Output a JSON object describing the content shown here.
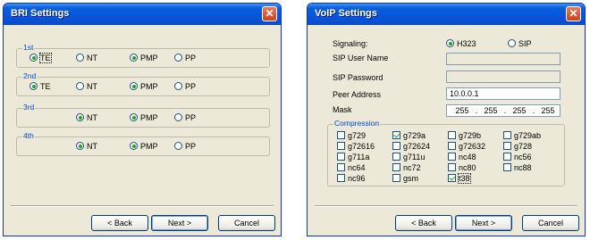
{
  "bri": {
    "title": "BRI Settings",
    "close": "✕",
    "ports": [
      {
        "label": "1st",
        "te": "TE",
        "nt": "NT",
        "pmp": "PMP",
        "pp": "PP"
      },
      {
        "label": "2nd",
        "te": "TE",
        "nt": "NT",
        "pmp": "PMP",
        "pp": "PP"
      },
      {
        "label": "3rd",
        "nt": "NT",
        "pmp": "PMP",
        "pp": "PP"
      },
      {
        "label": "4th",
        "nt": "NT",
        "pmp": "PMP",
        "pp": "PP"
      }
    ],
    "buttons": {
      "back": "< Back",
      "next": "Next >",
      "cancel": "Cancel"
    }
  },
  "voip": {
    "title": "VoIP Settings",
    "close": "✕",
    "signaling_label": "Signaling:",
    "signaling_options": [
      "H323",
      "SIP"
    ],
    "sip_user_label": "SIP User Name",
    "sip_password_label": "SIP Password",
    "peer_address_label": "Peer Address",
    "peer_address_value": "10.0.0.1",
    "mask_label": "Mask",
    "mask_octets": [
      "255",
      "255",
      "255",
      "255"
    ],
    "mask_dot": ".",
    "compression_label": "Compression",
    "codecs": [
      {
        "name": "g729",
        "checked": false
      },
      {
        "name": "g729a",
        "checked": true
      },
      {
        "name": "g729b",
        "checked": false
      },
      {
        "name": "g729ab",
        "checked": false
      },
      {
        "name": "g72616",
        "checked": false
      },
      {
        "name": "g72624",
        "checked": false
      },
      {
        "name": "g72632",
        "checked": false
      },
      {
        "name": "g728",
        "checked": false
      },
      {
        "name": "g711a",
        "checked": false
      },
      {
        "name": "g711u",
        "checked": false
      },
      {
        "name": "nc48",
        "checked": false
      },
      {
        "name": "nc56",
        "checked": false
      },
      {
        "name": "nc64",
        "checked": false
      },
      {
        "name": "nc72",
        "checked": false
      },
      {
        "name": "nc80",
        "checked": false
      },
      {
        "name": "nc88",
        "checked": false
      },
      {
        "name": "nc96",
        "checked": false
      },
      {
        "name": "gsm",
        "checked": false
      },
      {
        "name": "t38",
        "checked": true
      }
    ],
    "buttons": {
      "back": "< Back",
      "next": "Next >",
      "cancel": "Cancel"
    }
  }
}
